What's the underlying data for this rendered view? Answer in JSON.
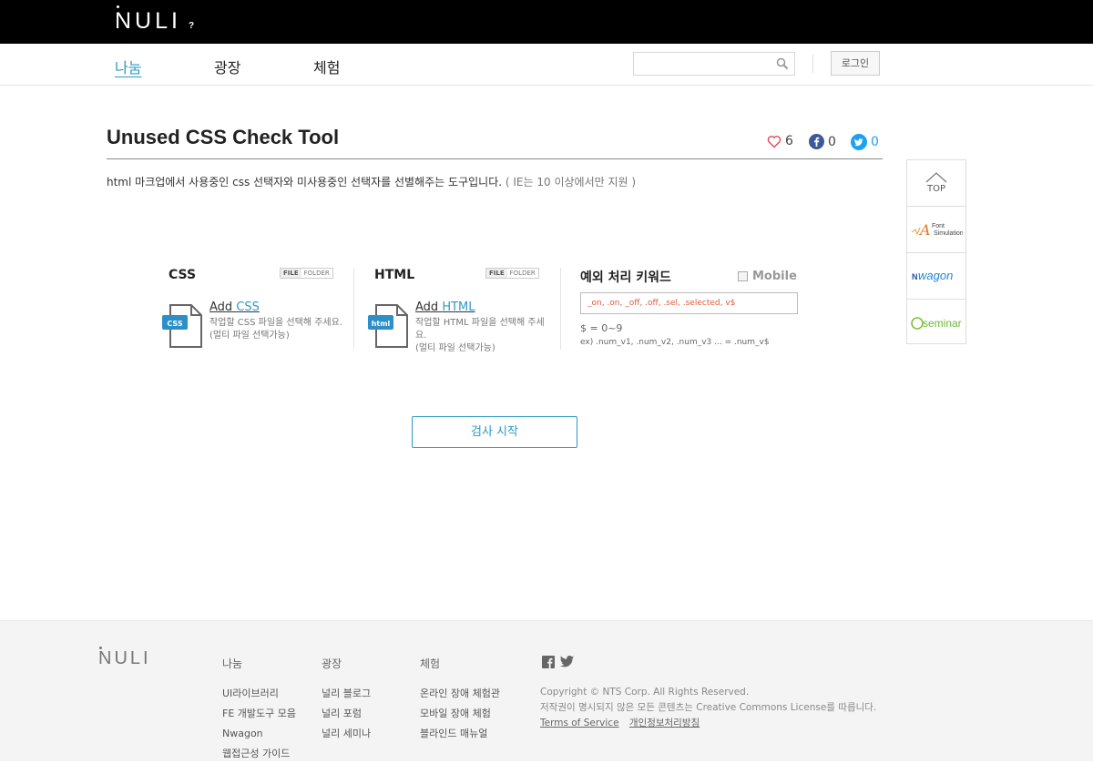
{
  "header": {
    "logo": "NULI",
    "logo_help": "?"
  },
  "nav": {
    "items": [
      "나눔",
      "광장",
      "체험"
    ],
    "search_placeholder": "",
    "login_label": "로그인"
  },
  "page": {
    "title": "Unused CSS Check Tool",
    "likes": "6",
    "facebook": "0",
    "twitter": "0",
    "description": "html 마크업에서 사용중인 css 선택자와 미사용중인 선택자를 선별해주는 도구입니다.",
    "description_note": "( IE는 10 이상에서만 지원 )"
  },
  "quick_menu": {
    "top_label": "TOP",
    "items": [
      "Font Simulation",
      "Nwagon",
      "seminar"
    ]
  },
  "tool": {
    "css": {
      "title": "CSS",
      "toggle_file": "FILE",
      "toggle_folder": "FOLDER",
      "icon_text": "CSS",
      "add_prefix": "Add ",
      "add_hl": "CSS",
      "hint1": "작업할 CSS 파일을 선택해 주세요.",
      "hint2": "(멀티 파일 선택가능)"
    },
    "html": {
      "title": "HTML",
      "toggle_file": "FILE",
      "toggle_folder": "FOLDER",
      "icon_text": "html",
      "add_prefix": "Add ",
      "add_hl": "HTML",
      "hint1": "작업할 HTML 파일을 선택해 주세요.",
      "hint2": "(멀티 파일 선택가능)"
    },
    "keywords": {
      "title": "예외 처리 키워드",
      "mobile_label": "Mobile",
      "mobile_checked": false,
      "input_value": "_on, .on, _off, .off, .sel, .selected, v$",
      "note1": "$ = 0~9",
      "note2": "ex) .num_v1, .num_v2, .num_v3 ... = .num_v$"
    },
    "start_label": "검사 시작"
  },
  "footer": {
    "logo": "NULI",
    "columns": [
      {
        "head": "나눔",
        "links": [
          "UI라이브러리",
          "FE 개발도구 모음",
          "Nwagon",
          "웹접근성 가이드"
        ]
      },
      {
        "head": "광장",
        "links": [
          "널리 블로그",
          "널리 포럼",
          "널리 세미나"
        ]
      },
      {
        "head": "체험",
        "links": [
          "온라인 장애 체험관",
          "모바일 장애 체험",
          "블라인드 매뉴얼"
        ]
      }
    ],
    "copyright": "Copyright © NTS Corp. All Rights Reserved.",
    "license": "저작권이 명시되지 않은 모든 콘텐츠는 Creative Commons License를 따릅니다.",
    "terms": "Terms of Service",
    "privacy": "개인정보처리방침"
  },
  "colors": {
    "accent": "#2d99c5",
    "heart": "#e2485a",
    "facebook": "#3b5998",
    "twitter": "#1da1f2"
  }
}
